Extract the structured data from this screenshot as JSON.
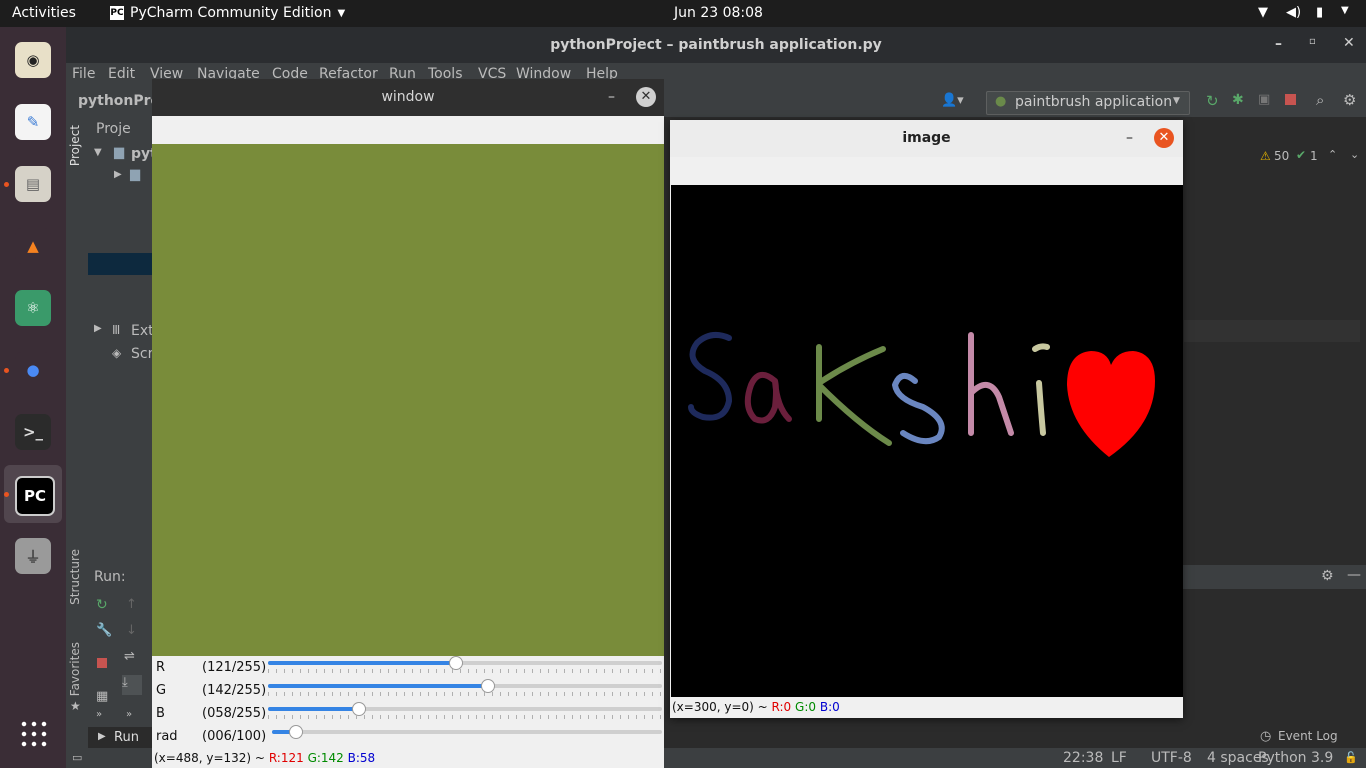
{
  "topbar": {
    "activities": "Activities",
    "app_name": "PyCharm Community Edition",
    "clock": "Jun 23  08:08"
  },
  "dock": {
    "apps": [
      {
        "name": "Rhythmbox",
        "icon": "music-icon",
        "glyph": "◉",
        "bg": "#e8e0c8",
        "fg": "#222"
      },
      {
        "name": "Text Editor",
        "icon": "text-editor-icon",
        "glyph": "✎",
        "bg": "#f4f4f4",
        "fg": "#3a7bd5"
      },
      {
        "name": "Files",
        "icon": "files-icon",
        "glyph": "▤",
        "bg": "#d6d2c8",
        "fg": "#666"
      },
      {
        "name": "VLC",
        "icon": "vlc-icon",
        "glyph": "▲",
        "bg": "#3a2d36",
        "fg": "#f58220"
      },
      {
        "name": "Atom",
        "icon": "atom-icon",
        "glyph": "⚛",
        "bg": "#3a9a6a",
        "fg": "#fff"
      },
      {
        "name": "Chrome",
        "icon": "chrome-icon",
        "glyph": "●",
        "bg": "#3a2d36",
        "fg": "#4a8af4"
      },
      {
        "name": "Terminal",
        "icon": "terminal-icon",
        "glyph": ">_",
        "bg": "#2b2b2b",
        "fg": "#ddd"
      },
      {
        "name": "PyCharm",
        "icon": "pycharm-icon",
        "glyph": "PC",
        "bg": "#000",
        "fg": "#fff"
      },
      {
        "name": "USB",
        "icon": "usb-icon",
        "glyph": "⏚",
        "bg": "#9a9a9a",
        "fg": "#444"
      }
    ]
  },
  "pycharm": {
    "title": "pythonProject – paintbrush application.py",
    "menu": [
      "File",
      "Edit",
      "View",
      "Navigate",
      "Code",
      "Refactor",
      "Run",
      "Tools",
      "VCS",
      "Window",
      "Help"
    ],
    "project_label": "pythonPro",
    "run_config": "paintbrush application",
    "warnings": "50",
    "checks": "1",
    "side_tabs": {
      "project": "Project",
      "structure": "Structure",
      "favorites": "Favorites"
    },
    "tree": {
      "header": "Proje",
      "root": "pyt",
      "ext": "Ext",
      "scr": "Scr"
    },
    "run_label": "Run:",
    "run_tab": "Run",
    "event_log": "Event Log",
    "status": {
      "pos": "22:38",
      "lf": "LF",
      "enc": "UTF-8",
      "indent": "4 spaces",
      "interp": "Python 3.9"
    }
  },
  "window": {
    "title": "window",
    "fill_color": "#798c3a",
    "sliders": [
      {
        "name": "R",
        "value_text": "(121/255)",
        "fraction": 0.4745
      },
      {
        "name": "G",
        "value_text": "(142/255)",
        "fraction": 0.5569
      },
      {
        "name": "B",
        "value_text": "(058/255)",
        "fraction": 0.2275
      },
      {
        "name": "rad",
        "value_text": "(006/100)",
        "fraction": 0.06
      }
    ],
    "status": {
      "coords": "(x=488, y=132) ~",
      "r": "R:121",
      "g": "G:142",
      "b": "B:58"
    }
  },
  "image": {
    "title": "image",
    "status": {
      "coords": "(x=300, y=0) ~",
      "r": "R:0",
      "g": "G:0",
      "b": "B:0"
    },
    "strokes": [
      {
        "char": "S",
        "color": "#1e2a5c"
      },
      {
        "char": "a",
        "color": "#6b1f3c"
      },
      {
        "char": "k",
        "color": "#6c8a4a"
      },
      {
        "char": "s",
        "color": "#6a86c0"
      },
      {
        "char": "h",
        "color": "#c48aa8"
      },
      {
        "char": "i",
        "color": "#c8c8a0"
      },
      {
        "char": "heart",
        "color": "#ff0000"
      }
    ]
  },
  "colors": {
    "r": "#e00000",
    "g": "#008a00",
    "b": "#0000d0",
    "accent": "#3584e4"
  }
}
